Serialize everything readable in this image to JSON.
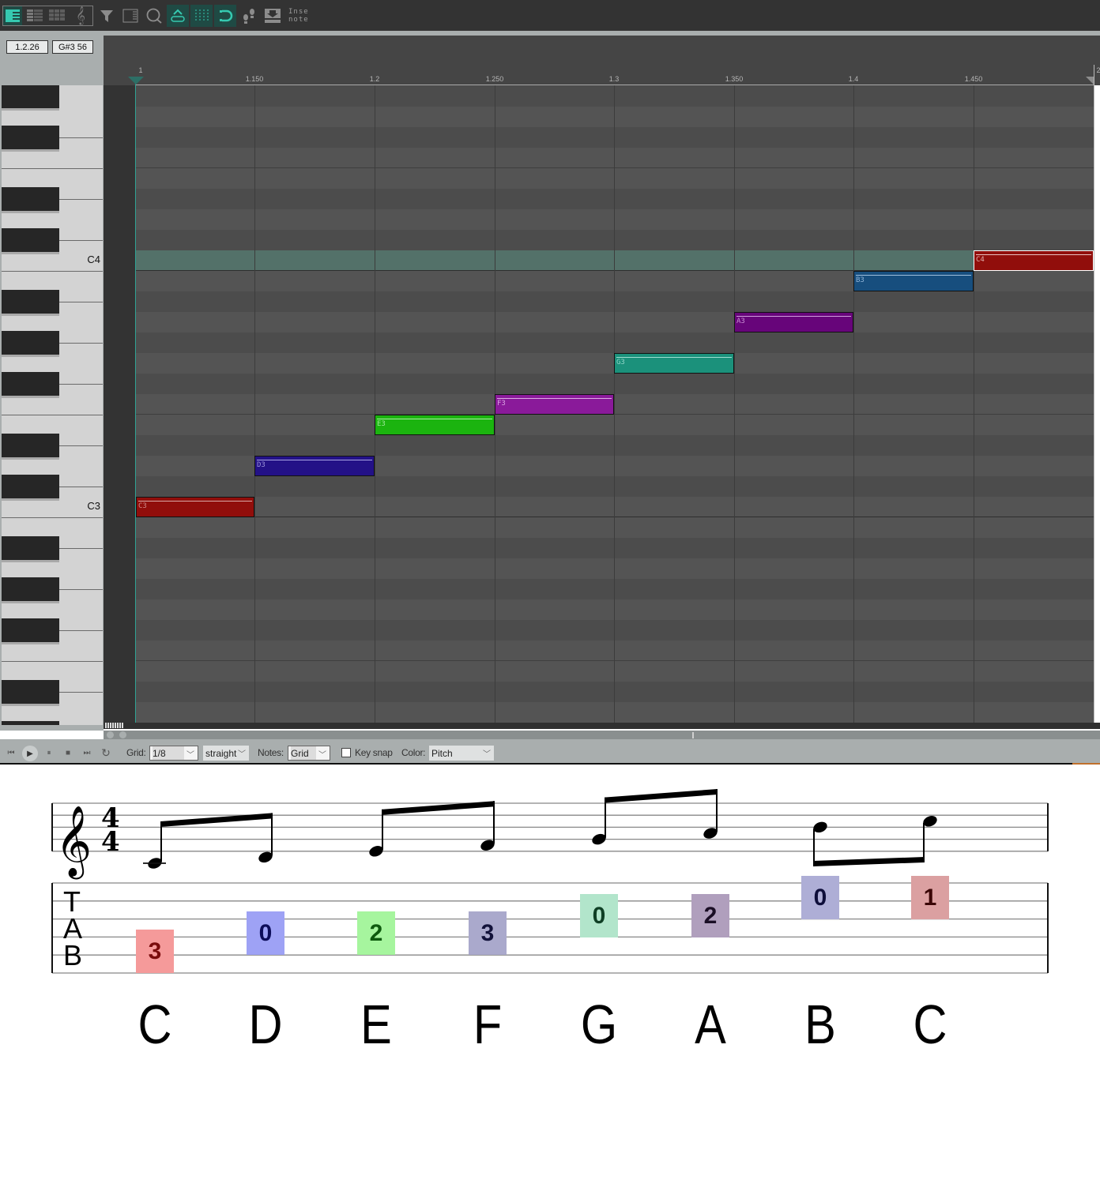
{
  "toolbar": {
    "view_buttons": [
      {
        "icon": "piano-roll-icon",
        "active": true
      },
      {
        "icon": "named-notes-icon",
        "active": false
      },
      {
        "icon": "drum-grid-icon",
        "active": false
      },
      {
        "icon": "treble-clef-icon",
        "active": false
      }
    ],
    "tool_buttons": [
      {
        "icon": "filter-icon",
        "active": false
      },
      {
        "icon": "event-list-icon",
        "active": false
      },
      {
        "icon": "quantize-icon",
        "active": false
      },
      {
        "icon": "link-cc-icon",
        "active": true
      },
      {
        "icon": "grid-snap-icon",
        "active": true
      },
      {
        "icon": "loop-icon",
        "active": true
      },
      {
        "icon": "step-input-icon",
        "active": false
      },
      {
        "icon": "insert-note-icon",
        "active": false
      }
    ],
    "insert_label_line1": "Inse",
    "insert_label_line2": "note"
  },
  "readouts": {
    "position": "1.2.26",
    "pitch": "G#3  56"
  },
  "ruler": {
    "ticks": [
      "1",
      "1.150",
      "1.2",
      "1.250",
      "1.3",
      "1.350",
      "1.4",
      "1.450",
      "2"
    ]
  },
  "piano": {
    "octave_labels": [
      {
        "label": "C4",
        "pitch": "C4"
      },
      {
        "label": "C3",
        "pitch": "C3"
      }
    ],
    "highlighted_row": "C4"
  },
  "notes": [
    {
      "label": "C3",
      "pitch": "C3",
      "start_step": 0,
      "length_steps": 1,
      "color": "#910e0b",
      "label_color": "#d08a88",
      "vel_color": "#d9a9a8",
      "selected": false
    },
    {
      "label": "D3",
      "pitch": "D3",
      "start_step": 1,
      "length_steps": 1,
      "color": "#231187",
      "label_color": "#9b93d9",
      "vel_color": "#a9a3e4",
      "selected": false
    },
    {
      "label": "E3",
      "pitch": "E3",
      "start_step": 2,
      "length_steps": 1,
      "color": "#1bb40f",
      "label_color": "#9fe79a",
      "vel_color": "#a8eaa2",
      "selected": false
    },
    {
      "label": "F3",
      "pitch": "F3",
      "start_step": 3,
      "length_steps": 1,
      "color": "#8a1a9a",
      "label_color": "#d9a2e2",
      "vel_color": "#dcaee4",
      "selected": false
    },
    {
      "label": "G3",
      "pitch": "G3",
      "start_step": 4,
      "length_steps": 1,
      "color": "#1b917b",
      "label_color": "#8fd3c6",
      "vel_color": "#a0dccf",
      "selected": false
    },
    {
      "label": "A3",
      "pitch": "A3",
      "start_step": 5,
      "length_steps": 1,
      "color": "#67057a",
      "label_color": "#c88ed3",
      "vel_color": "#cf9edb",
      "selected": false
    },
    {
      "label": "B3",
      "pitch": "B3",
      "start_step": 6,
      "length_steps": 1,
      "color": "#174e7e",
      "label_color": "#8fb3d6",
      "vel_color": "#9fbedc",
      "selected": false
    },
    {
      "label": "C4",
      "pitch": "C4",
      "start_step": 7,
      "length_steps": 1,
      "color": "#910e0b",
      "label_color": "#e0b0ae",
      "vel_color": "#e9c1c0",
      "selected": true
    }
  ],
  "bottombar": {
    "transport": [
      {
        "name": "rewind-icon",
        "glyph": "⏮"
      },
      {
        "name": "play-icon",
        "glyph": "▶"
      },
      {
        "name": "pause-icon",
        "glyph": "⏸"
      },
      {
        "name": "stop-icon",
        "glyph": "■"
      },
      {
        "name": "forward-icon",
        "glyph": "⏭"
      },
      {
        "name": "repeat-icon",
        "glyph": "↻"
      }
    ],
    "grid_label": "Grid:",
    "grid_value": "1/8",
    "grid_type": "straight",
    "notes_label": "Notes:",
    "notes_value": "Grid",
    "keysnap_label": "Key snap",
    "keysnap_checked": false,
    "color_label": "Color:",
    "color_value": "Pitch"
  },
  "score": {
    "clef": "treble",
    "time_signature": {
      "top": "4",
      "bottom": "4"
    },
    "tab_label": [
      "T",
      "A",
      "B"
    ],
    "notes": [
      {
        "name": "C",
        "staff_step": -2,
        "tab_string": 5,
        "fret": "3",
        "box_color": "#f59a9a",
        "num_color": "#7a0c0c"
      },
      {
        "name": "D",
        "staff_step": -1,
        "tab_string": 4,
        "fret": "0",
        "box_color": "#9ea2f5",
        "num_color": "#0d0d5a"
      },
      {
        "name": "E",
        "staff_step": 0,
        "tab_string": 4,
        "fret": "2",
        "box_color": "#a6f59e",
        "num_color": "#0e5a0e"
      },
      {
        "name": "F",
        "staff_step": 1,
        "tab_string": 4,
        "fret": "3",
        "box_color": "#aaa9cc",
        "num_color": "#12123a"
      },
      {
        "name": "G",
        "staff_step": 2,
        "tab_string": 3,
        "fret": "0",
        "box_color": "#b2e5cb",
        "num_color": "#0f3f25"
      },
      {
        "name": "A",
        "staff_step": 3,
        "tab_string": 3,
        "fret": "2",
        "box_color": "#b09fbd",
        "num_color": "#1a0e25"
      },
      {
        "name": "B",
        "staff_step": 4,
        "tab_string": 2,
        "fret": "0",
        "box_color": "#aeaed6",
        "num_color": "#0e0e3a"
      },
      {
        "name": "C",
        "staff_step": 5,
        "tab_string": 2,
        "fret": "1",
        "box_color": "#dba0a1",
        "num_color": "#3a0606"
      }
    ]
  }
}
